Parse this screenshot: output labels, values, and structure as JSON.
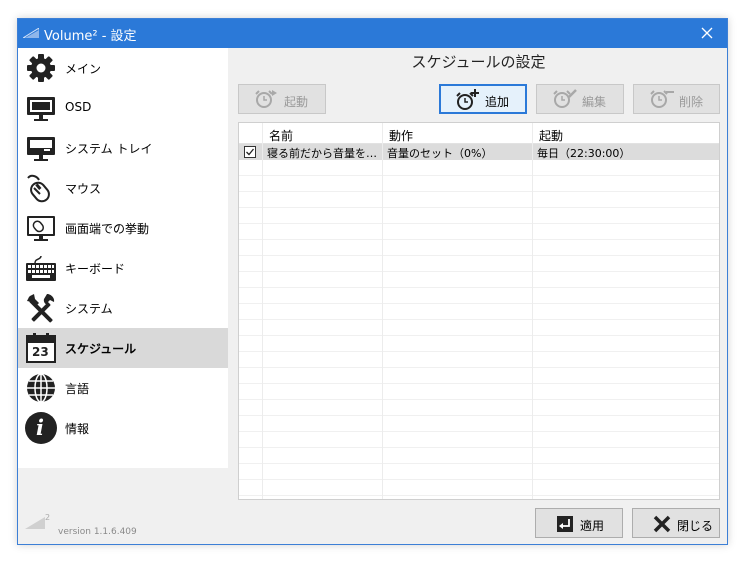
{
  "window": {
    "title": "Volume² - 設定"
  },
  "sidebar": {
    "items": [
      {
        "label": "メイン",
        "icon": "gear-icon"
      },
      {
        "label": "OSD",
        "icon": "monitor-icon"
      },
      {
        "label": "システム トレイ",
        "icon": "system-tray-icon"
      },
      {
        "label": "マウス",
        "icon": "mouse-icon"
      },
      {
        "label": "画面端での挙動",
        "icon": "screen-edge-icon"
      },
      {
        "label": "キーボード",
        "icon": "keyboard-icon"
      },
      {
        "label": "システム",
        "icon": "tools-icon"
      },
      {
        "label": "スケジュール",
        "icon": "calendar-icon",
        "day": "23"
      },
      {
        "label": "言語",
        "icon": "globe-icon"
      },
      {
        "label": "情報",
        "icon": "info-icon",
        "glyph": "i"
      }
    ],
    "active_index": 7
  },
  "version": {
    "logo_sup": "2",
    "text": "version 1.1.6.409"
  },
  "main": {
    "title": "スケジュールの設定",
    "toolbar": {
      "start": "起動",
      "add": "追加",
      "edit": "編集",
      "delete": "削除"
    },
    "table": {
      "columns": [
        "名前",
        "動作",
        "起動"
      ],
      "rows": [
        {
          "checked": true,
          "name": "寝る前だから音量を…",
          "action": "音量のセット（0%）",
          "trigger": "毎日（22:30:00）"
        }
      ]
    }
  },
  "footer": {
    "apply": "適用",
    "close": "閉じる"
  },
  "colors": {
    "titlebar": "#2b79d8",
    "accent": "#2b79d8",
    "active_item": "#d9d9d9",
    "selected_row": "#dcdcdc"
  }
}
